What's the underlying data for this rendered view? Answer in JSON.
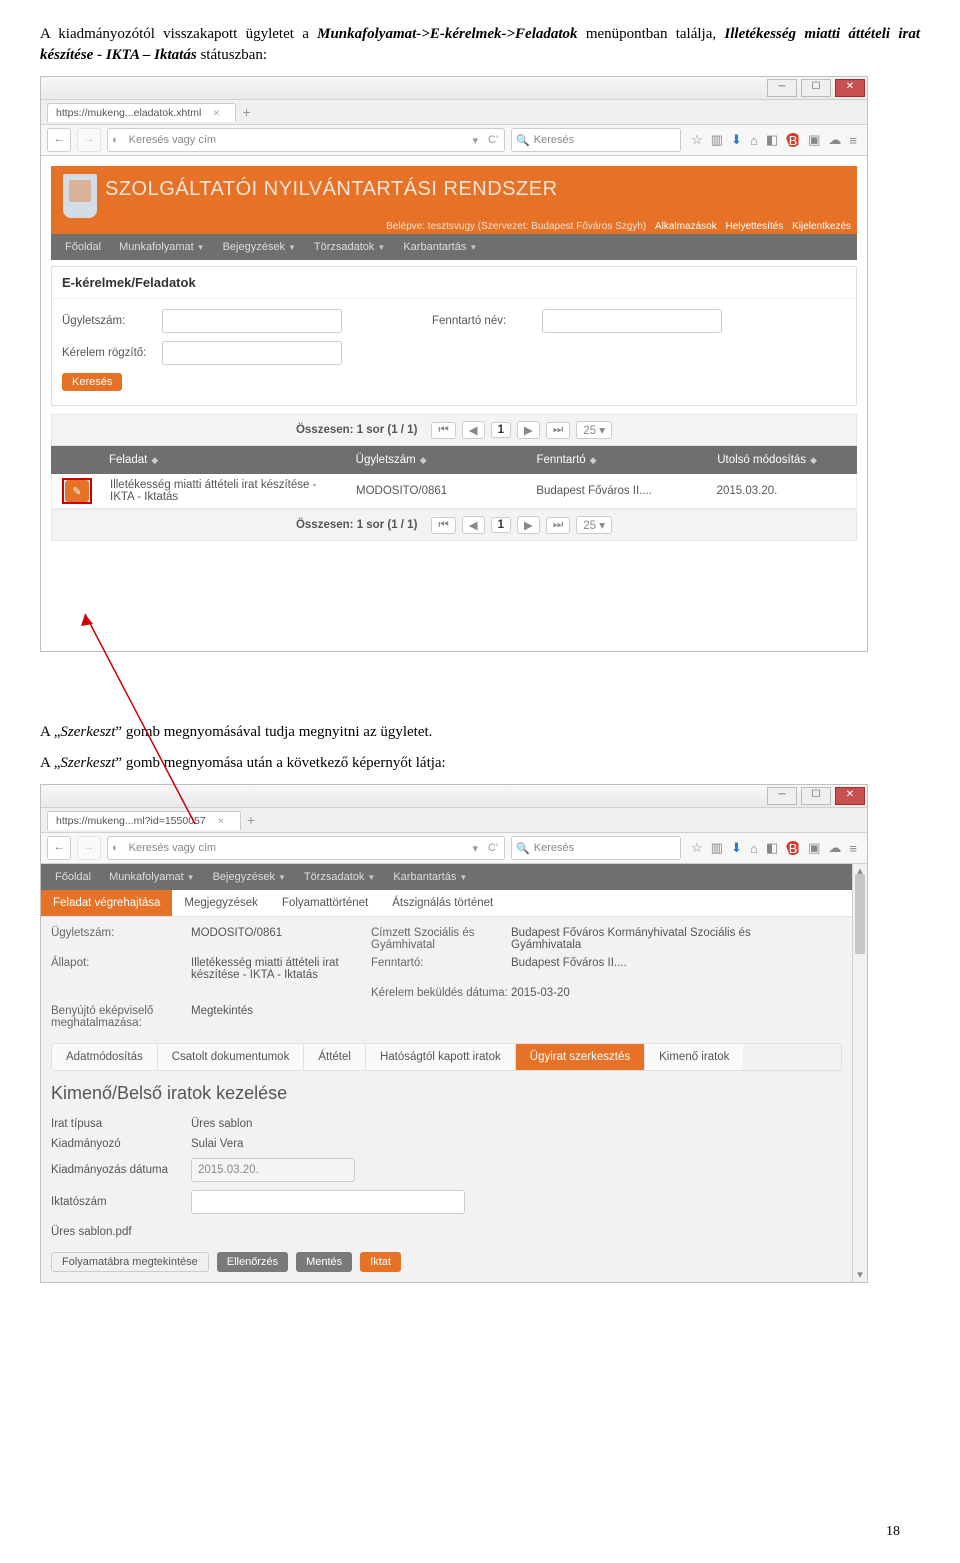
{
  "doc": {
    "intro_pre": "A kiadmányozótól visszakapott ügyletet a ",
    "intro_menu": "Munkafolyamat->E-kérelmek->Feladatok",
    "intro_post1": " menüpontban találja, ",
    "intro_status": "Illetékesség miatti áttételi irat készítése - IKTA – Iktatás",
    "intro_post2": " státuszban:",
    "mid1": "A „",
    "mid_italic1": "Szerkeszt",
    "mid2": "” gomb megnyomásával tudja megnyitni az ügyletet.",
    "mid3": "A „",
    "mid_italic2": "Szerkeszt",
    "mid4": "” gomb megnyomása után a következő képernyőt látja:",
    "page_number": "18"
  },
  "shot1": {
    "tab": "https://mukeng...eladatok.xhtml",
    "addr_placeholder": "Keresés vagy cím",
    "search_placeholder": "Keresés",
    "app_title": "SZOLGÁLTATÓI NYILVÁNTARTÁSI RENDSZER",
    "login_pre": "Belépve: tesztsvugy (Szervezet: Budapest Főváros Szgyh)",
    "login_links": [
      "Alkalmazások",
      "Helyettesítés",
      "Kijelentkezés"
    ],
    "menu": [
      "Főoldal",
      "Munkafolyamat",
      "Bejegyzések",
      "Törzsadatok",
      "Karbantartás"
    ],
    "panel_title": "E-kérelmek/Feladatok",
    "labels": {
      "ugyletszam": "Ügyletszám:",
      "fenntarto_nev": "Fenntartó név:",
      "kerelem_rogzito": "Kérelem rögzítő:"
    },
    "search_btn": "Keresés",
    "pager_summary": "Összesen: 1 sor (1 / 1)",
    "page_size": "25",
    "columns": [
      "Feladat",
      "Ügyletszám",
      "Fenntartó",
      "Utolsó módosítás"
    ],
    "row": {
      "feladat": "Illetékesség miatti áttételi irat készítése - IKTA - Iktatás",
      "ugyletszam": "MODOSITO/0861",
      "fenntarto": "Budapest Főváros II....",
      "modositas": "2015.03.20."
    }
  },
  "shot2": {
    "tab": "https://mukeng...ml?id=1550057",
    "addr_placeholder": "Keresés vagy cím",
    "search_placeholder": "Keresés",
    "menu": [
      "Főoldal",
      "Munkafolyamat",
      "Bejegyzések",
      "Törzsadatok",
      "Karbantartás"
    ],
    "tabs": [
      "Feladat végrehajtása",
      "Megjegyzések",
      "Folyamattörténet",
      "Átszignálás történet"
    ],
    "details": {
      "ugyletszam_k": "Ügyletszám:",
      "ugyletszam_v": "MODOSITO/0861",
      "cimzett_k": "Címzett Szociális és Gyámhivatal",
      "cimzett_v": "Budapest Főváros Kormányhivatal Szociális és Gyámhivatala",
      "allapot_k": "Állapot:",
      "allapot_v": "Illetékesség miatti áttételi irat készítése - IKTA - Iktatás",
      "fenntarto_k": "Fenntartó:",
      "fenntarto_v": "Budapest Főváros II....",
      "bekuldes_k": "Kérelem beküldés dátuma:",
      "bekuldes_v": "2015-03-20",
      "benyujto_k": "Benyújtó eképviselő meghatalmazása:",
      "benyujto_v": "Megtekintés"
    },
    "subtabs": [
      "Adatmódosítás",
      "Csatolt dokumentumok",
      "Áttétel",
      "Hatóságtól kapott iratok",
      "Ügyirat szerkesztés",
      "Kimenő iratok"
    ],
    "panel_h3": "Kimenő/Belső iratok kezelése",
    "kv": {
      "irat_tipusa_k": "Irat típusa",
      "irat_tipusa_v": "Üres sablon",
      "kiadmanyozo_k": "Kiadmányozó",
      "kiadmanyozo_v": "Sulai Vera",
      "kiadm_datum_k": "Kiadmányozás dátuma",
      "kiadm_datum_v": "2015.03.20.",
      "iktatoszam_k": "Iktatószám",
      "doc_link": "Üres sablon.pdf"
    },
    "buttons": [
      "Folyamatábra megtekintése",
      "Ellenőrzés",
      "Mentés",
      "Iktat"
    ]
  }
}
